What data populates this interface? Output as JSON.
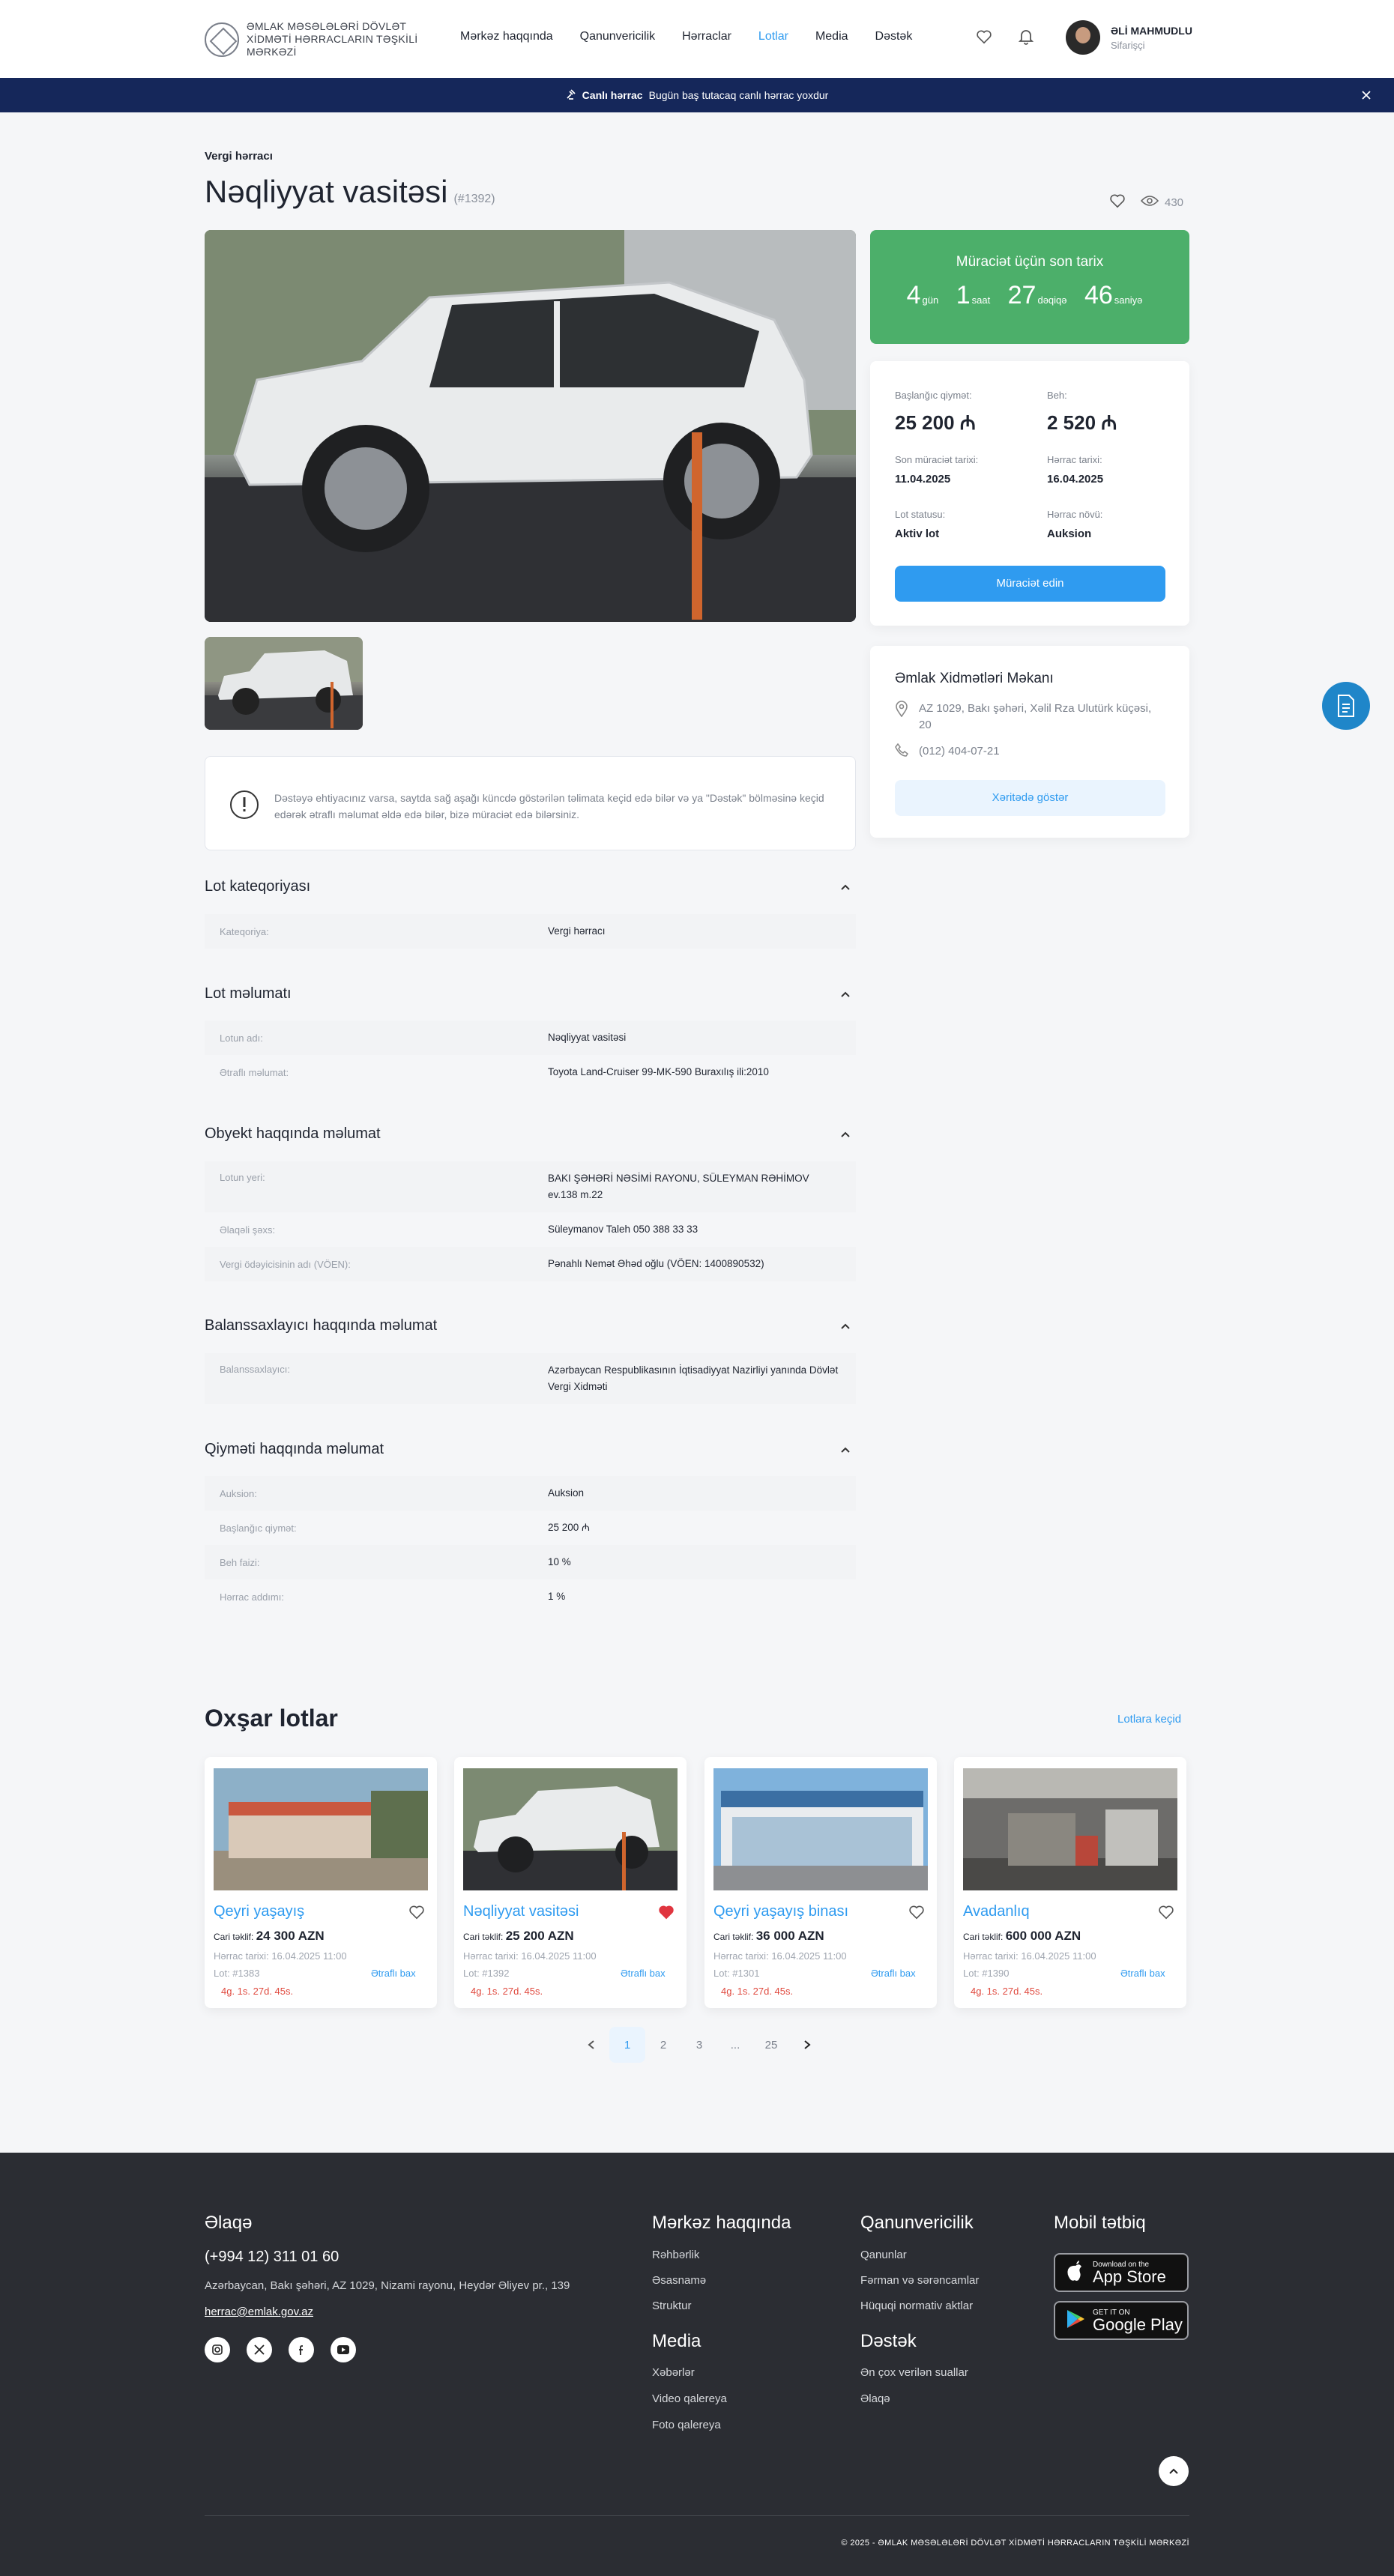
{
  "header": {
    "logo_text": "ƏMLAK MƏSƏLƏLƏRİ DÖVLƏT XİDMƏTİ HƏRRACLARIN TƏŞKİLİ MƏRKƏZİ",
    "nav": [
      "Mərkəz haqqında",
      "Qanunvericilik",
      "Hərraclar",
      "Lotlar",
      "Media",
      "Dəstək"
    ],
    "active_nav": "Lotlar",
    "user_name": "ƏLİ MAHMUDLU",
    "user_role": "Sifarişçi"
  },
  "livebar": {
    "label": "Canlı hərrac",
    "text": "Bugün baş tutacaq canlı hərrac yoxdur"
  },
  "lot": {
    "breadcrumb": "Vergi hərracı",
    "title": "Nəqliyyat vasitəsi",
    "lot_code": "(#1392)",
    "views": "430"
  },
  "timer": {
    "label": "Müraciət üçün son tarix",
    "days": "4",
    "days_unit": "gün",
    "hours": "1",
    "hours_unit": "saat",
    "minutes": "27",
    "minutes_unit": "dəqiqə",
    "seconds": "46",
    "seconds_unit": "saniyə"
  },
  "summary": {
    "start_price_label": "Başlanğıc qiymət:",
    "start_price": "25 200 ₼",
    "deposit_label": "Beh:",
    "deposit": "2 520 ₼",
    "deadline_label": "Son müraciət tarixi:",
    "deadline": "11.04.2025",
    "auction_date_label": "Hərrac tarixi:",
    "auction_date": "16.04.2025",
    "status_label": "Lot statusu:",
    "status": "Aktiv lot",
    "type_label": "Hərrac növü:",
    "type": "Auksion",
    "apply_button": "Müraciət edin"
  },
  "office": {
    "title": "Əmlak Xidmətləri Məkanı",
    "address": "AZ 1029, Bakı şəhəri, Xəlil Rza Ulutürk küçəsi, 20",
    "phone": "(012) 404-07-21",
    "map_button": "Xəritədə göstər"
  },
  "note": "Dəstəyə ehtiyacınız varsa, saytda sağ aşağı küncdə göstərilən təlimata keçid edə bilər və ya \"Dəstək\" bölməsinə keçid edərək ətraflı məlumat əldə edə bilər, bizə müraciət edə bilərsiniz.",
  "sections": {
    "category": {
      "title": "Lot kateqoriyası",
      "rows": [
        {
          "k": "Kateqoriya:",
          "v": "Vergi hərracı"
        }
      ]
    },
    "lotinfo": {
      "title": "Lot məlumatı",
      "rows": [
        {
          "k": "Lotun adı:",
          "v": "Nəqliyyat vasitəsi"
        },
        {
          "k": "Ətraflı məlumat:",
          "v": "Toyota Land-Cruiser 99-MK-590 Buraxılış ili:2010"
        }
      ]
    },
    "object": {
      "title": "Obyekt haqqında məlumat",
      "rows": [
        {
          "k": "Lotun yeri:",
          "v": "BAKI ŞƏHƏRİ NƏSİMİ RAYONU, SÜLEYMAN RƏHİMOV ev.138 m.22"
        },
        {
          "k": "Əlaqəli şəxs:",
          "v": "Süleymanov Taleh 050 388 33 33"
        },
        {
          "k": "Vergi ödəyicisinin adı (VÖEN):",
          "v": "Pənahlı Nemət Əhəd oğlu (VÖEN: 1400890532)"
        }
      ]
    },
    "holder": {
      "title": "Balanssaxlayıcı haqqında məlumat",
      "rows": [
        {
          "k": "Balanssaxlayıcı:",
          "v": "Azərbaycan Respublikasının İqtisadiyyat Nazirliyi yanında Dövlət Vergi Xidməti"
        }
      ]
    },
    "price": {
      "title": "Qiyməti haqqında məlumat",
      "rows": [
        {
          "k": "Auksion:",
          "v": "Auksion"
        },
        {
          "k": "Başlanğıc qiymət:",
          "v": "25 200 ₼"
        },
        {
          "k": "Beh faizi:",
          "v": "10 %"
        },
        {
          "k": "Hərrac addımı:",
          "v": "1 %"
        }
      ]
    }
  },
  "similar": {
    "title": "Oxşar lotlar",
    "link": "Lotlara keçid",
    "bid_label": "Cari təklif:",
    "date_label": "Hərrac tarixi:",
    "more": "Ətraflı bax",
    "items": [
      {
        "name": "Qeyri yaşayış",
        "bid": "24 300 AZN",
        "date": "16.04.2025 11:00",
        "lot": "Lot: #1383",
        "timer": "4g. 1s. 27d. 45s.",
        "fav": false
      },
      {
        "name": "Nəqliyyat vasitəsi",
        "bid": "25 200 AZN",
        "date": "16.04.2025 11:00",
        "lot": "Lot: #1392",
        "timer": "4g. 1s. 27d. 45s.",
        "fav": true
      },
      {
        "name": "Qeyri yaşayış binası",
        "bid": "36 000 AZN",
        "date": "16.04.2025 11:00",
        "lot": "Lot: #1301",
        "timer": "4g. 1s. 27d. 45s.",
        "fav": false
      },
      {
        "name": "Avadanlıq",
        "bid": "600 000 AZN",
        "date": "16.04.2025 11:00",
        "lot": "Lot: #1390",
        "timer": "4g. 1s. 27d. 45s.",
        "fav": false
      }
    ]
  },
  "pagination": {
    "pages": [
      "1",
      "2",
      "3",
      "...",
      "25"
    ],
    "current": "1"
  },
  "footer": {
    "contact_title": "Əlaqə",
    "phone": "(+994 12) 311 01 60",
    "address": "Azərbaycan, Bakı şəhəri, AZ 1029, Nizami rayonu, Heydər Əliyev pr., 139",
    "email": "herrac@emlak.gov.az",
    "about_title": "Mərkəz haqqında",
    "about_links": [
      "Rəhbərlik",
      "Əsasnamə",
      "Struktur"
    ],
    "media_title": "Media",
    "media_links": [
      "Xəbərlər",
      "Video qalereya",
      "Foto qalereya"
    ],
    "law_title": "Qanunvericilik",
    "law_links": [
      "Qanunlar",
      "Fərman və sərəncamlar",
      "Hüquqi normativ aktlar"
    ],
    "support_title": "Dəstək",
    "support_links": [
      "Ən çox verilən suallar",
      "Əlaqə"
    ],
    "app_title": "Mobil tətbiq",
    "appstore_small": "Download on the",
    "appstore_big": "App Store",
    "gplay_small": "GET IT ON",
    "gplay_big": "Google Play",
    "copyright": "© 2025 - ƏMLAK MƏSƏLƏLƏRİ DÖVLƏT XİDMƏTİ HƏRRACLARIN TƏŞKİLİ MƏRKƏZİ"
  },
  "colors": {
    "accent": "#2f9bf0",
    "timer_bg": "#4caf6a",
    "live_bar": "#15275a",
    "footer_bg": "#2b2d33",
    "timer_text": "#e04a3f"
  }
}
